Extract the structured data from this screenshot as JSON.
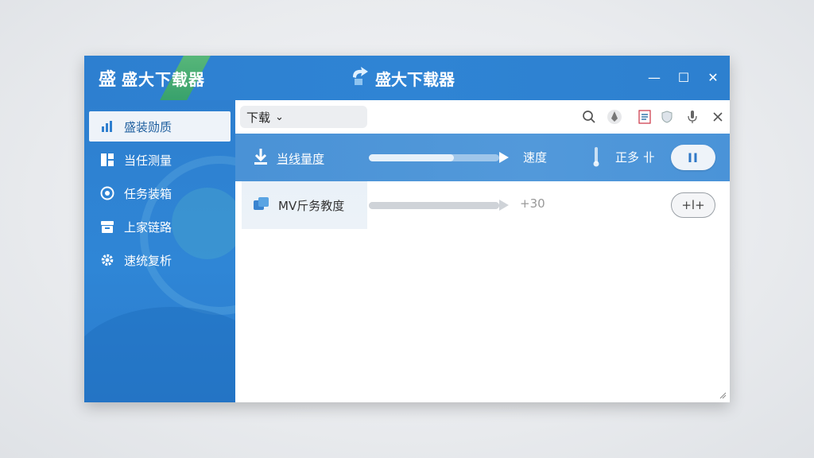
{
  "app": {
    "title": "盛大下载器",
    "center_title": "盛大下载器",
    "brand_logo_text": "盛"
  },
  "window_controls": {
    "minimize": "—",
    "maximize": "☐",
    "close": "✕"
  },
  "sidebar": {
    "items": [
      {
        "label": "盛装勋质",
        "icon": "chart-icon",
        "active": true
      },
      {
        "label": "当任测量",
        "icon": "layout-icon",
        "active": false
      },
      {
        "label": "任务装箱",
        "icon": "eye-icon",
        "active": false
      },
      {
        "label": "上家链路",
        "icon": "archive-icon",
        "active": false
      },
      {
        "label": "速统复析",
        "icon": "gear-icon",
        "active": false
      }
    ]
  },
  "toolbar": {
    "dropdown_value": "下载",
    "dropdown_caret": "⌄",
    "icons": [
      "search-icon",
      "flame-icon",
      "document-icon",
      "shield-icon",
      "microphone-icon",
      "close-icon"
    ]
  },
  "rows": [
    {
      "name": "当线量度",
      "speed_label": "速度",
      "status": "正多 卝",
      "progress": 0.65,
      "action": "pause",
      "action_label": "II"
    },
    {
      "name": "MV斤务教度",
      "speed_value": "+30",
      "progress": 1.0,
      "action_label": "+l+"
    }
  ],
  "colors": {
    "primary": "#2f84d4",
    "row_highlight": "#4d95d8",
    "sidebar_active_bg": "#eef3f9",
    "brand_green": "#4cb361"
  }
}
